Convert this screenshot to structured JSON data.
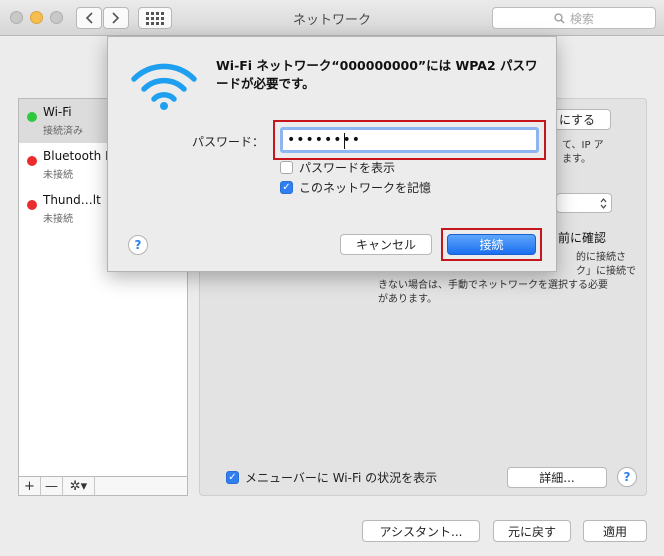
{
  "window": {
    "title": "ネットワーク",
    "search_placeholder": "検索"
  },
  "services": [
    {
      "name": "Wi-Fi",
      "status": "接続済み",
      "color": "#2fc93f"
    },
    {
      "name": "Bluetooth P",
      "status": "未接続",
      "color": "#ea2c2c"
    },
    {
      "name": "Thund…lt",
      "status": "未接続",
      "color": "#ea2c2c"
    }
  ],
  "sidebar_tools": {
    "add": "+",
    "remove": "—",
    "gear": "✲▾"
  },
  "panel": {
    "partial_button": "にする",
    "partial_text_1": "て、IP ア",
    "partial_text_2": "ます。",
    "partial_heading": "前に確認",
    "partial_text_3": "的に接続さ",
    "partial_text_4": "ク」に接続で",
    "partial_text_5": "きない場合は、手動でネットワークを選択する必要",
    "partial_text_6": "があります。",
    "show_status_label": "メニューバーに Wi-Fi の状況を表示",
    "show_status_checked": true,
    "advanced_button": "詳細...",
    "help": "?"
  },
  "bottom": {
    "assistant": "アシスタント...",
    "revert": "元に戻す",
    "apply": "適用"
  },
  "dialog": {
    "message": "Wi-Fi ネットワーク“000000000”には WPA2 パスワードが必要です。",
    "password_label": "パスワード：",
    "password_value": "••••••••",
    "show_password_label": "パスワードを表示",
    "show_password_checked": false,
    "remember_label": "このネットワークを記憶",
    "remember_checked": true,
    "help": "?",
    "cancel": "キャンセル",
    "connect": "接続",
    "accent_color": "#1b6ff0",
    "highlight_color": "#c4161c"
  }
}
